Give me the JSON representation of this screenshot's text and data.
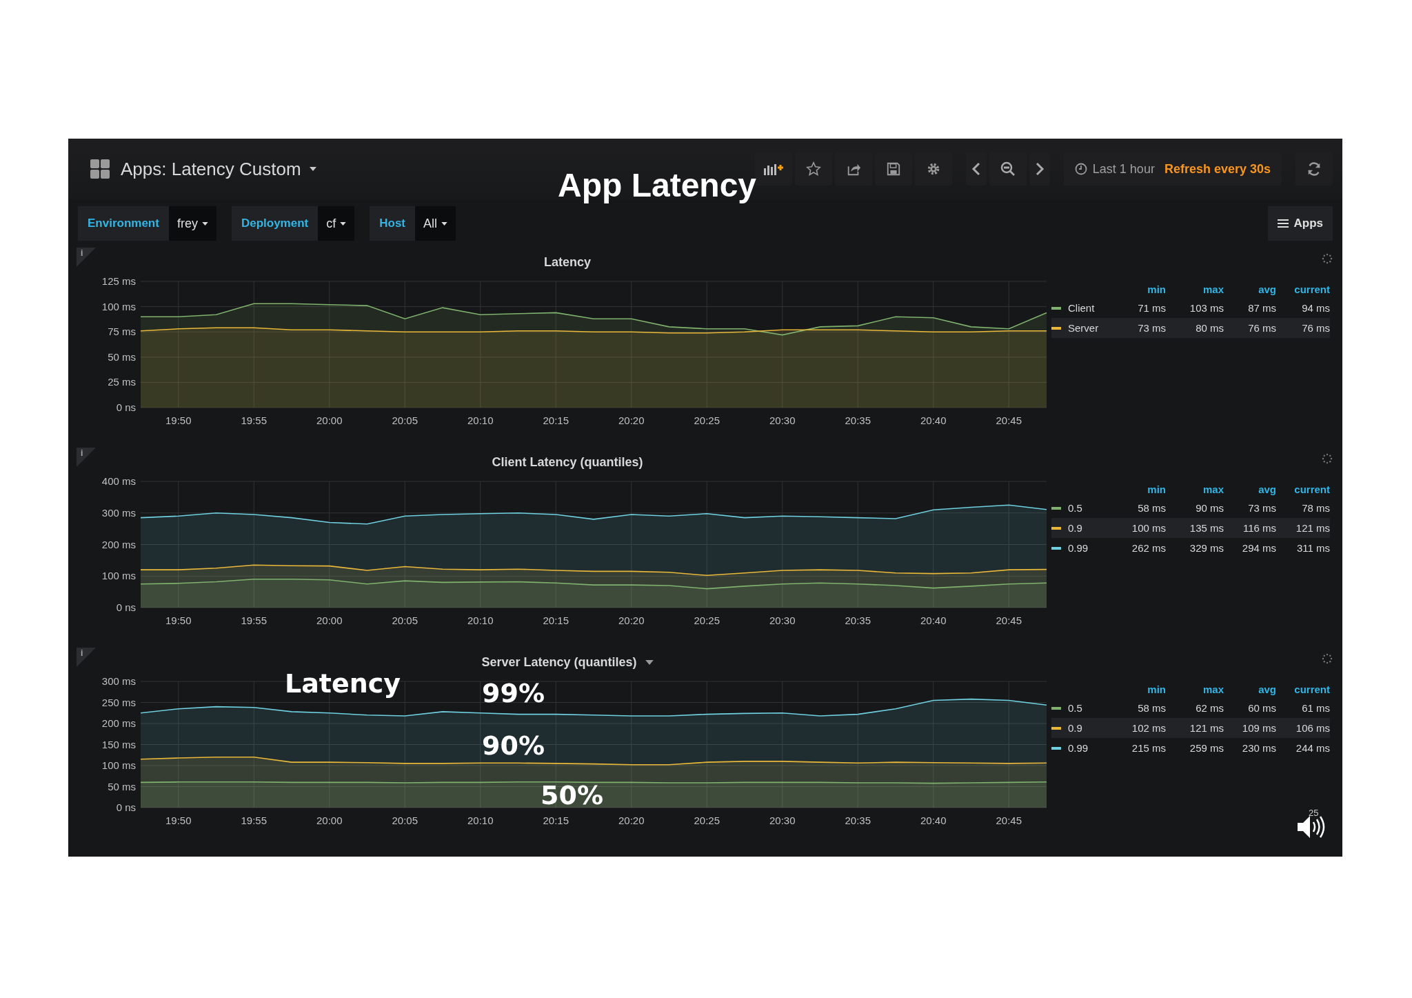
{
  "dashboard": {
    "title": "Apps: Latency Custom"
  },
  "toolbar": [
    {
      "kind": "add_panel"
    },
    {
      "kind": "star"
    },
    {
      "kind": "share"
    },
    {
      "kind": "save"
    },
    {
      "kind": "settings"
    }
  ],
  "nav": [
    {
      "kind": "prev"
    },
    {
      "kind": "zoom_out"
    },
    {
      "kind": "next"
    }
  ],
  "time_picker": {
    "range": "Last 1 hour",
    "refresh": "Refresh every 30s"
  },
  "refresh_button": {
    "kind": "refresh"
  },
  "variables": [
    {
      "label": "Environment",
      "value": "frey"
    },
    {
      "label": "Deployment",
      "value": "cf"
    },
    {
      "label": "Host",
      "value": "All"
    }
  ],
  "apps_button": {
    "label": "Apps"
  },
  "panels": [
    {
      "title": "Latency",
      "info_mark": "i",
      "title_menu": false,
      "legend_columns": [
        "min",
        "max",
        "avg",
        "current"
      ],
      "legend": [
        {
          "min": "71 ms",
          "max": "103 ms",
          "avg": "87 ms",
          "current": "94 ms",
          "highlighted": false
        },
        {
          "min": "73 ms",
          "max": "80 ms",
          "avg": "76 ms",
          "current": "76 ms",
          "highlighted": true
        }
      ],
      "chart_data": {
        "type": "area",
        "categories": [
          null,
          "19:50",
          null,
          "19:55",
          null,
          "20:00",
          null,
          "20:05",
          null,
          "20:10",
          null,
          "20:15",
          null,
          "20:20",
          null,
          "20:25",
          null,
          "20:30",
          null,
          "20:35",
          null,
          "20:40",
          null,
          "20:45",
          null
        ],
        "grid": true,
        "ylim": [
          0,
          125
        ],
        "yticks": [
          {
            "value": 0,
            "label": "0 ns"
          },
          {
            "value": 25,
            "label": "25 ms"
          },
          {
            "value": 50,
            "label": "50 ms"
          },
          {
            "value": 75,
            "label": "75 ms"
          },
          {
            "value": 100,
            "label": "100 ms"
          },
          {
            "value": 125,
            "label": "125 ms"
          }
        ],
        "series": [
          {
            "name": "Client",
            "color": "#7eb26d",
            "values": [
              90,
              90,
              92,
              103,
              103,
              102,
              101,
              88,
              99,
              92,
              93,
              94,
              88,
              88,
              80,
              78,
              78,
              72,
              80,
              81,
              90,
              89,
              80,
              78,
              94
            ]
          },
          {
            "name": "Server",
            "color": "#eab839",
            "values": [
              76,
              78,
              79,
              79,
              77,
              77,
              76,
              75,
              75,
              75,
              76,
              76,
              75,
              75,
              74,
              74,
              75,
              77,
              77,
              77,
              76,
              75,
              75,
              76,
              76
            ]
          }
        ]
      }
    },
    {
      "title": "Client Latency (quantiles)",
      "info_mark": "i",
      "title_menu": false,
      "legend_columns": [
        "min",
        "max",
        "avg",
        "current"
      ],
      "legend": [
        {
          "min": "58 ms",
          "max": "90 ms",
          "avg": "73 ms",
          "current": "78 ms",
          "highlighted": false
        },
        {
          "min": "100 ms",
          "max": "135 ms",
          "avg": "116 ms",
          "current": "121 ms",
          "highlighted": true
        },
        {
          "min": "262 ms",
          "max": "329 ms",
          "avg": "294 ms",
          "current": "311 ms",
          "highlighted": false
        }
      ],
      "chart_data": {
        "type": "area",
        "categories": [
          null,
          "19:50",
          null,
          "19:55",
          null,
          "20:00",
          null,
          "20:05",
          null,
          "20:10",
          null,
          "20:15",
          null,
          "20:20",
          null,
          "20:25",
          null,
          "20:30",
          null,
          "20:35",
          null,
          "20:40",
          null,
          "20:45",
          null
        ],
        "grid": true,
        "ylim": [
          0,
          400
        ],
        "yticks": [
          {
            "value": 0,
            "label": "0 ns"
          },
          {
            "value": 100,
            "label": "100 ms"
          },
          {
            "value": 200,
            "label": "200 ms"
          },
          {
            "value": 300,
            "label": "300 ms"
          },
          {
            "value": 400,
            "label": "400 ms"
          }
        ],
        "series": [
          {
            "name": "0.5",
            "color": "#7eb26d",
            "values": [
              75,
              77,
              82,
              90,
              90,
              88,
              75,
              85,
              80,
              81,
              82,
              78,
              72,
              72,
              70,
              60,
              68,
              75,
              78,
              75,
              70,
              62,
              68,
              75,
              78
            ]
          },
          {
            "name": "0.9",
            "color": "#eab839",
            "values": [
              120,
              120,
              125,
              135,
              133,
              132,
              118,
              130,
              122,
              120,
              122,
              118,
              115,
              115,
              112,
              102,
              110,
              118,
              120,
              118,
              110,
              108,
              110,
              120,
              121
            ]
          },
          {
            "name": "0.99",
            "color": "#6ed0e0",
            "values": [
              285,
              290,
              300,
              295,
              285,
              270,
              265,
              290,
              295,
              298,
              300,
              295,
              280,
              295,
              290,
              298,
              285,
              290,
              288,
              285,
              282,
              310,
              318,
              325,
              311
            ]
          }
        ]
      }
    },
    {
      "title": "Server Latency (quantiles)",
      "info_mark": "i",
      "title_menu": true,
      "legend_columns": [
        "min",
        "max",
        "avg",
        "current"
      ],
      "legend": [
        {
          "min": "58 ms",
          "max": "62 ms",
          "avg": "60 ms",
          "current": "61 ms",
          "highlighted": false
        },
        {
          "min": "102 ms",
          "max": "121 ms",
          "avg": "109 ms",
          "current": "106 ms",
          "highlighted": true
        },
        {
          "min": "215 ms",
          "max": "259 ms",
          "avg": "230 ms",
          "current": "244 ms",
          "highlighted": false
        }
      ],
      "chart_data": {
        "type": "area",
        "categories": [
          null,
          "19:50",
          null,
          "19:55",
          null,
          "20:00",
          null,
          "20:05",
          null,
          "20:10",
          null,
          "20:15",
          null,
          "20:20",
          null,
          "20:25",
          null,
          "20:30",
          null,
          "20:35",
          null,
          "20:40",
          null,
          "20:45",
          null
        ],
        "grid": true,
        "ylim": [
          0,
          300
        ],
        "yticks": [
          {
            "value": 0,
            "label": "0 ns"
          },
          {
            "value": 50,
            "label": "50 ms"
          },
          {
            "value": 100,
            "label": "100 ms"
          },
          {
            "value": 150,
            "label": "150 ms"
          },
          {
            "value": 200,
            "label": "200 ms"
          },
          {
            "value": 250,
            "label": "250 ms"
          },
          {
            "value": 300,
            "label": "300 ms"
          }
        ],
        "series": [
          {
            "name": "0.5",
            "color": "#7eb26d",
            "values": [
              60,
              61,
              61,
              61,
              60,
              60,
              60,
              59,
              60,
              60,
              61,
              61,
              60,
              60,
              59,
              59,
              60,
              60,
              60,
              59,
              59,
              58,
              59,
              60,
              61
            ]
          },
          {
            "name": "0.9",
            "color": "#eab839",
            "values": [
              115,
              118,
              120,
              120,
              108,
              108,
              107,
              105,
              105,
              106,
              106,
              105,
              104,
              102,
              102,
              108,
              110,
              110,
              108,
              106,
              108,
              107,
              106,
              105,
              106
            ]
          },
          {
            "name": "0.99",
            "color": "#6ed0e0",
            "values": [
              225,
              235,
              240,
              238,
              228,
              225,
              220,
              218,
              228,
              225,
              222,
              222,
              220,
              218,
              218,
              222,
              224,
              225,
              218,
              222,
              235,
              255,
              258,
              255,
              244
            ]
          }
        ]
      }
    }
  ],
  "overlays": {
    "title": "App Latency",
    "labels": [
      "Latency",
      "99%",
      "90%",
      "50%"
    ],
    "slide_number": "25"
  }
}
